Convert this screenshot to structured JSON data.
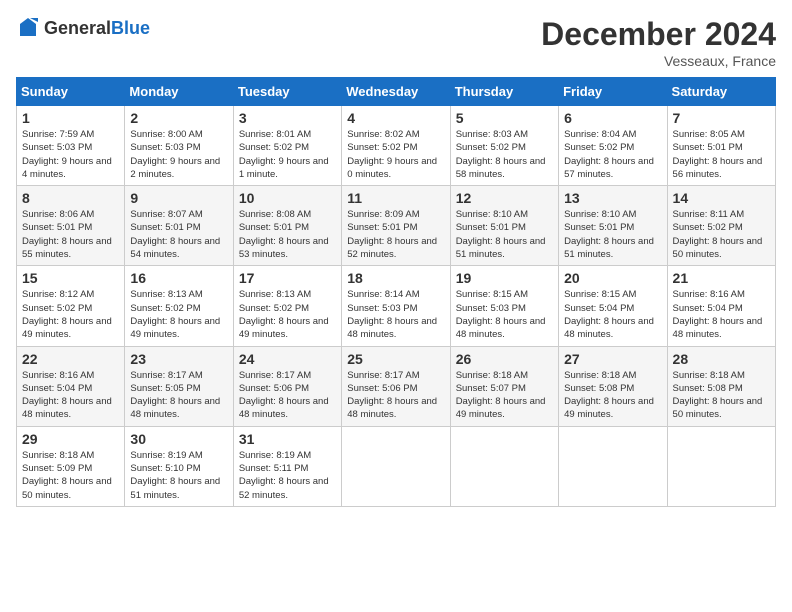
{
  "header": {
    "logo_general": "General",
    "logo_blue": "Blue",
    "title": "December 2024",
    "location": "Vesseaux, France"
  },
  "weekdays": [
    "Sunday",
    "Monday",
    "Tuesday",
    "Wednesday",
    "Thursday",
    "Friday",
    "Saturday"
  ],
  "weeks": [
    [
      {
        "day": "1",
        "info": "Sunrise: 7:59 AM\nSunset: 5:03 PM\nDaylight: 9 hours and 4 minutes."
      },
      {
        "day": "2",
        "info": "Sunrise: 8:00 AM\nSunset: 5:03 PM\nDaylight: 9 hours and 2 minutes."
      },
      {
        "day": "3",
        "info": "Sunrise: 8:01 AM\nSunset: 5:02 PM\nDaylight: 9 hours and 1 minute."
      },
      {
        "day": "4",
        "info": "Sunrise: 8:02 AM\nSunset: 5:02 PM\nDaylight: 9 hours and 0 minutes."
      },
      {
        "day": "5",
        "info": "Sunrise: 8:03 AM\nSunset: 5:02 PM\nDaylight: 8 hours and 58 minutes."
      },
      {
        "day": "6",
        "info": "Sunrise: 8:04 AM\nSunset: 5:02 PM\nDaylight: 8 hours and 57 minutes."
      },
      {
        "day": "7",
        "info": "Sunrise: 8:05 AM\nSunset: 5:01 PM\nDaylight: 8 hours and 56 minutes."
      }
    ],
    [
      {
        "day": "8",
        "info": "Sunrise: 8:06 AM\nSunset: 5:01 PM\nDaylight: 8 hours and 55 minutes."
      },
      {
        "day": "9",
        "info": "Sunrise: 8:07 AM\nSunset: 5:01 PM\nDaylight: 8 hours and 54 minutes."
      },
      {
        "day": "10",
        "info": "Sunrise: 8:08 AM\nSunset: 5:01 PM\nDaylight: 8 hours and 53 minutes."
      },
      {
        "day": "11",
        "info": "Sunrise: 8:09 AM\nSunset: 5:01 PM\nDaylight: 8 hours and 52 minutes."
      },
      {
        "day": "12",
        "info": "Sunrise: 8:10 AM\nSunset: 5:01 PM\nDaylight: 8 hours and 51 minutes."
      },
      {
        "day": "13",
        "info": "Sunrise: 8:10 AM\nSunset: 5:01 PM\nDaylight: 8 hours and 51 minutes."
      },
      {
        "day": "14",
        "info": "Sunrise: 8:11 AM\nSunset: 5:02 PM\nDaylight: 8 hours and 50 minutes."
      }
    ],
    [
      {
        "day": "15",
        "info": "Sunrise: 8:12 AM\nSunset: 5:02 PM\nDaylight: 8 hours and 49 minutes."
      },
      {
        "day": "16",
        "info": "Sunrise: 8:13 AM\nSunset: 5:02 PM\nDaylight: 8 hours and 49 minutes."
      },
      {
        "day": "17",
        "info": "Sunrise: 8:13 AM\nSunset: 5:02 PM\nDaylight: 8 hours and 49 minutes."
      },
      {
        "day": "18",
        "info": "Sunrise: 8:14 AM\nSunset: 5:03 PM\nDaylight: 8 hours and 48 minutes."
      },
      {
        "day": "19",
        "info": "Sunrise: 8:15 AM\nSunset: 5:03 PM\nDaylight: 8 hours and 48 minutes."
      },
      {
        "day": "20",
        "info": "Sunrise: 8:15 AM\nSunset: 5:04 PM\nDaylight: 8 hours and 48 minutes."
      },
      {
        "day": "21",
        "info": "Sunrise: 8:16 AM\nSunset: 5:04 PM\nDaylight: 8 hours and 48 minutes."
      }
    ],
    [
      {
        "day": "22",
        "info": "Sunrise: 8:16 AM\nSunset: 5:04 PM\nDaylight: 8 hours and 48 minutes."
      },
      {
        "day": "23",
        "info": "Sunrise: 8:17 AM\nSunset: 5:05 PM\nDaylight: 8 hours and 48 minutes."
      },
      {
        "day": "24",
        "info": "Sunrise: 8:17 AM\nSunset: 5:06 PM\nDaylight: 8 hours and 48 minutes."
      },
      {
        "day": "25",
        "info": "Sunrise: 8:17 AM\nSunset: 5:06 PM\nDaylight: 8 hours and 48 minutes."
      },
      {
        "day": "26",
        "info": "Sunrise: 8:18 AM\nSunset: 5:07 PM\nDaylight: 8 hours and 49 minutes."
      },
      {
        "day": "27",
        "info": "Sunrise: 8:18 AM\nSunset: 5:08 PM\nDaylight: 8 hours and 49 minutes."
      },
      {
        "day": "28",
        "info": "Sunrise: 8:18 AM\nSunset: 5:08 PM\nDaylight: 8 hours and 50 minutes."
      }
    ],
    [
      {
        "day": "29",
        "info": "Sunrise: 8:18 AM\nSunset: 5:09 PM\nDaylight: 8 hours and 50 minutes."
      },
      {
        "day": "30",
        "info": "Sunrise: 8:19 AM\nSunset: 5:10 PM\nDaylight: 8 hours and 51 minutes."
      },
      {
        "day": "31",
        "info": "Sunrise: 8:19 AM\nSunset: 5:11 PM\nDaylight: 8 hours and 52 minutes."
      },
      null,
      null,
      null,
      null
    ]
  ]
}
